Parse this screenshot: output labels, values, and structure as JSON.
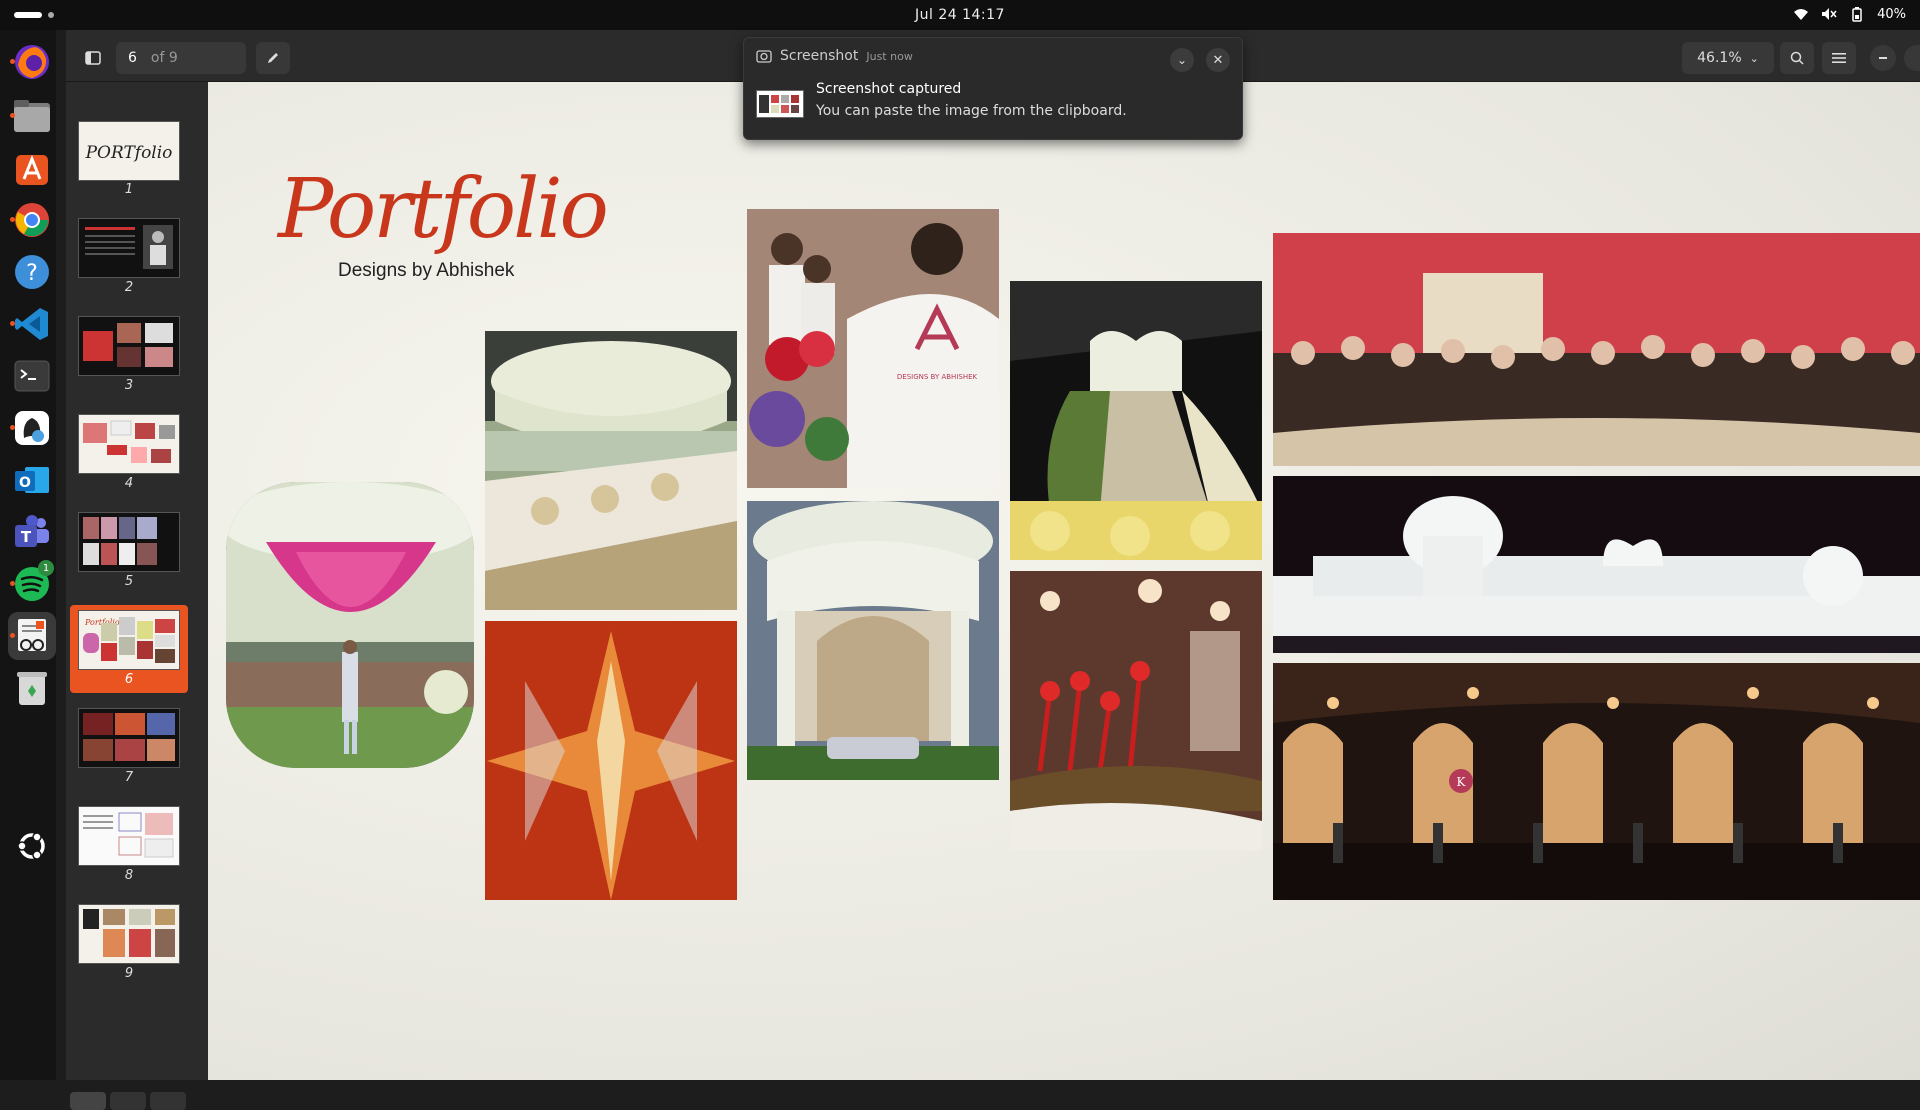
{
  "topbar": {
    "clock": "Jul 24  14:17",
    "battery": "40%"
  },
  "dock": {
    "apps": [
      "firefox",
      "files",
      "app-center",
      "chrome",
      "help",
      "vscode",
      "terminal",
      "inkscape",
      "outlook",
      "teams",
      "spotify",
      "document-viewer",
      "trash",
      "show-apps"
    ],
    "spotify_badge": "1"
  },
  "headerbar": {
    "page_current": "6",
    "page_total": "of 9",
    "zoom": "46.1%"
  },
  "thumbnails": {
    "pages": [
      "1",
      "2",
      "3",
      "4",
      "5",
      "6",
      "7",
      "8",
      "9"
    ],
    "selected": "6"
  },
  "document": {
    "title": "Portfolio",
    "subtitle": "Designs by Abhishek",
    "brand_mark": "A",
    "brand_text": "DESIGNS BY ABHISHEK"
  },
  "toast": {
    "app_name": "Screenshot",
    "time": "Just now",
    "title": "Screenshot captured",
    "body": "You can paste the image from the clipboard."
  },
  "colors": {
    "accent": "#e95420",
    "title_red": "#c8361c"
  }
}
